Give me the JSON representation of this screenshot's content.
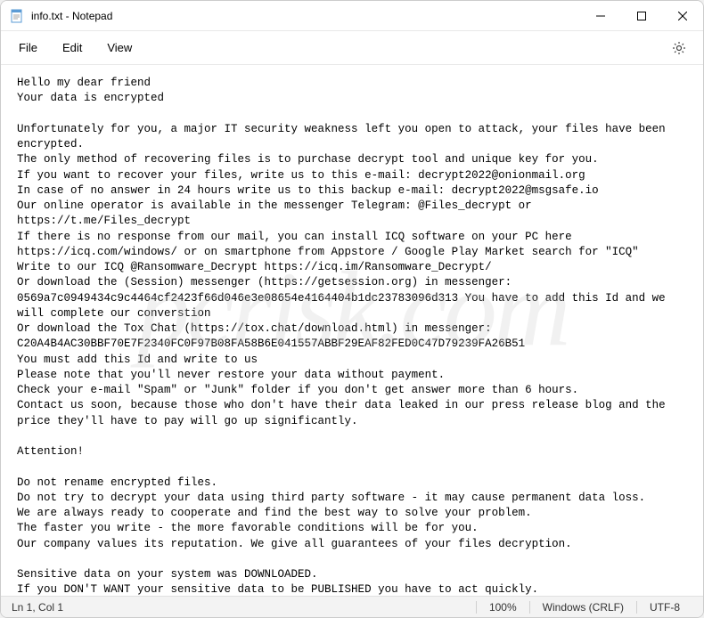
{
  "titlebar": {
    "title": "info.txt - Notepad"
  },
  "menubar": {
    "file": "File",
    "edit": "Edit",
    "view": "View"
  },
  "content": {
    "text": "Hello my dear friend\nYour data is encrypted\n\nUnfortunately for you, a major IT security weakness left you open to attack, your files have been encrypted.\nThe only method of recovering files is to purchase decrypt tool and unique key for you.\nIf you want to recover your files, write us to this e-mail: decrypt2022@onionmail.org\nIn case of no answer in 24 hours write us to this backup e-mail: decrypt2022@msgsafe.io\nOur online operator is available in the messenger Telegram: @Files_decrypt or https://t.me/Files_decrypt\nIf there is no response from our mail, you can install ICQ software on your PC here https://icq.com/windows/ or on smartphone from Appstore / Google Play Market search for \"ICQ\"\nWrite to our ICQ @Ransomware_Decrypt https://icq.im/Ransomware_Decrypt/\nOr download the (Session) messenger (https://getsession.org) in messenger: 0569a7c0949434c9c4464cf2423f66d046e3e08654e4164404b1dc23783096d313 You have to add this Id and we will complete our converstion\nOr download the Tox Chat (https://tox.chat/download.html) in messenger: C20A4B4AC30BBF70E7F2340FC0F97B08FA58B6E041557ABBF29EAF82FED0C47D79239FA26B51\nYou must add this Id and write to us\nPlease note that you'll never restore your data without payment.\nCheck your e-mail \"Spam\" or \"Junk\" folder if you don't get answer more than 6 hours.\nContact us soon, because those who don't have their data leaked in our press release blog and the price they'll have to pay will go up significantly.\n\nAttention!\n\nDo not rename encrypted files.\nDo not try to decrypt your data using third party software - it may cause permanent data loss.\nWe are always ready to cooperate and find the best way to solve your problem.\nThe faster you write - the more favorable conditions will be for you.\nOur company values its reputation. We give all guarantees of your files decryption.\n\nSensitive data on your system was DOWNLOADED.\nIf you DON'T WANT your sensitive data to be PUBLISHED you have to act quickly.\n\nData includes:\n- Employees personal data, CVs, DL, SSN.\n- Complete network map including credentials for local and remote services.\n- Private financial information including: clients data, bills, budgets, annual reports, bank statements.\n- Manufacturing documents including: datagrams, schemas, drawings in solidworks format\n- And more..."
  },
  "statusbar": {
    "position": "Ln 1, Col 1",
    "zoom": "100%",
    "lineending": "Windows (CRLF)",
    "encoding": "UTF-8"
  },
  "watermark": "pcrisk.com"
}
